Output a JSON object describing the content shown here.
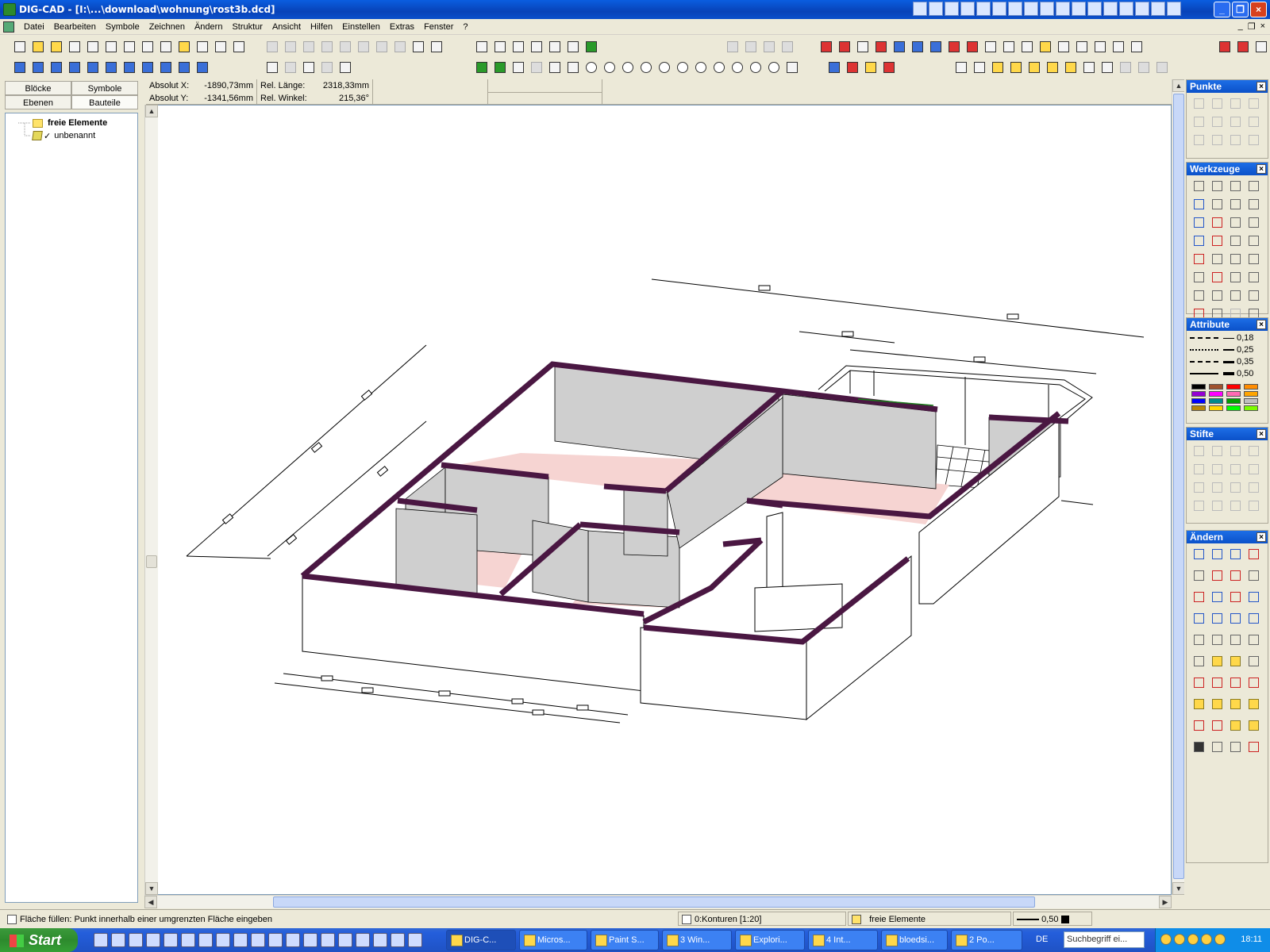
{
  "window": {
    "title": "DIG-CAD - [I:\\...\\download\\wohnung\\rost3b.dcd]"
  },
  "menu": {
    "items": [
      "Datei",
      "Bearbeiten",
      "Symbole",
      "Zeichnen",
      "Ändern",
      "Struktur",
      "Ansicht",
      "Hilfen",
      "Einstellen",
      "Extras",
      "Fenster",
      "?"
    ]
  },
  "left_panel": {
    "tabs_row1": [
      "Blöcke",
      "Symbole"
    ],
    "tabs_row2": [
      "Ebenen",
      "Bauteile"
    ],
    "active_tab": "Bauteile",
    "tree": [
      {
        "label": "freie Elemente",
        "bold": true,
        "icon": "folder-icon"
      },
      {
        "label": "unbenannt",
        "bold": false,
        "icon": "cube-icon",
        "checked": true
      }
    ]
  },
  "coords": {
    "absolut_x_label": "Absolut X:",
    "absolut_x_value": "-1890,73mm",
    "absolut_y_label": "Absolut Y:",
    "absolut_y_value": "-1341,56mm",
    "rel_laenge_label": "Rel. Länge:",
    "rel_laenge_value": "2318,33mm",
    "rel_winkel_label": "Rel. Winkel:",
    "rel_winkel_value": "215,36°"
  },
  "palettes": {
    "punkte": {
      "title": "Punkte",
      "close": "×"
    },
    "werkzeuge": {
      "title": "Werkzeuge",
      "close": "×"
    },
    "attribute": {
      "title": "Attribute",
      "close": "×",
      "line_widths": [
        "0,18",
        "0,25",
        "0,35",
        "0,50"
      ],
      "colors": [
        "#000000",
        "#a0522d",
        "#ff0000",
        "#ff8c00",
        "#9400d3",
        "#ff00ff",
        "#ff69b4",
        "#ffa500",
        "#0000ff",
        "#008b8b",
        "#00a000",
        "#c0c0c0",
        "#b8860b",
        "#ffd700",
        "#00ff00",
        "#7cfc00"
      ]
    },
    "stifte": {
      "title": "Stifte",
      "close": "×"
    },
    "aendern": {
      "title": "Ändern",
      "close": "×"
    }
  },
  "status": {
    "message": "Fläche füllen: Punkt innerhalb einer umgrenzten Fläche eingeben",
    "layer": "0:Konturen [1:20]",
    "group": "freie Elemente",
    "pen": "0,50"
  },
  "taskbar": {
    "start_label": "Start",
    "buttons": [
      "DIG-C...",
      "Micros...",
      "Paint S...",
      "3 Win...",
      "Explori...",
      "4 Int...",
      "bloedsi...",
      "2 Po..."
    ],
    "language": "DE",
    "search_placeholder": "Suchbegriff ei...",
    "clock": "18:11"
  },
  "colors": {
    "wall_cap": "#4a1742",
    "floor": "#f6d4d2",
    "wall_face": "#cfcfcf",
    "titlebar": "#0a4fcb"
  }
}
